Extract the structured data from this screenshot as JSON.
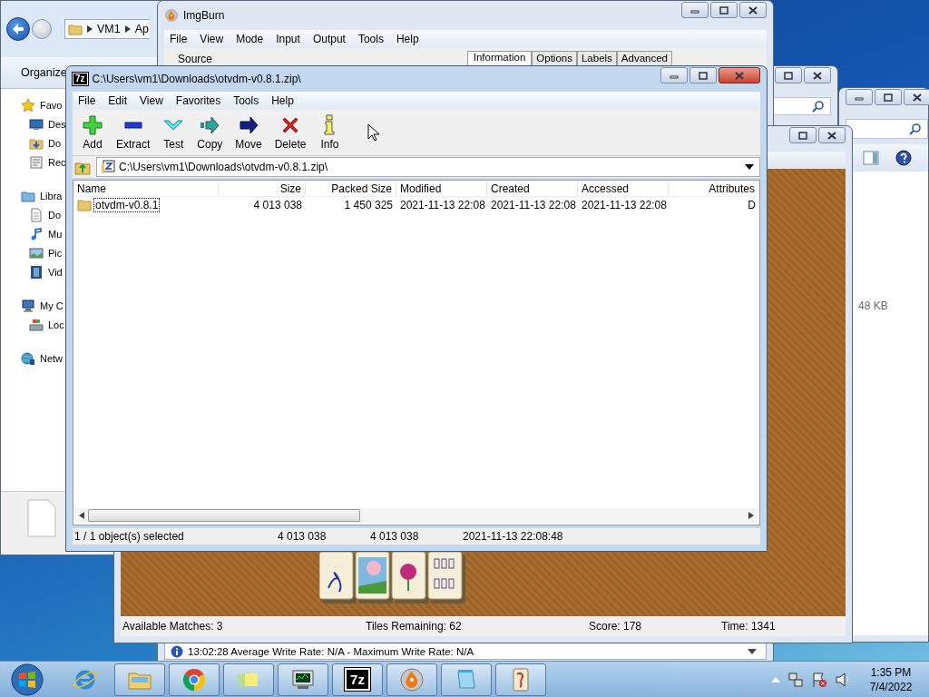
{
  "explorer": {
    "breadcrumb": [
      "VM1",
      "Ap"
    ],
    "toolbar": [
      "Organize"
    ],
    "nav": [
      {
        "label": "Favo",
        "kind": "star",
        "children": [
          {
            "label": "Des",
            "kind": "desktop"
          },
          {
            "label": "Do",
            "kind": "downloads"
          },
          {
            "label": "Rec",
            "kind": "recent"
          }
        ]
      },
      {
        "label": "Libra",
        "kind": "library",
        "children": [
          {
            "label": "Do",
            "kind": "document"
          },
          {
            "label": "Mu",
            "kind": "music"
          },
          {
            "label": "Pic",
            "kind": "pictures"
          },
          {
            "label": "Vid",
            "kind": "video"
          }
        ]
      },
      {
        "label": "My C",
        "kind": "computer",
        "children": [
          {
            "label": "Loc",
            "kind": "disk"
          }
        ]
      },
      {
        "label": "Netw",
        "kind": "network"
      }
    ]
  },
  "explorer_right": {
    "size_text": "48 KB"
  },
  "imgburn": {
    "title": "ImgBurn",
    "menu": [
      "File",
      "View",
      "Mode",
      "Input",
      "Output",
      "Tools",
      "Help"
    ],
    "source_label": "Source",
    "tabs": [
      {
        "label": "Information",
        "selected": true
      },
      {
        "label": "Options",
        "selected": false
      },
      {
        "label": "Labels",
        "selected": false
      },
      {
        "label": "Advanced",
        "selected": false
      }
    ],
    "status": "13:02:28 Average Write Rate: N/A - Maximum Write Rate: N/A"
  },
  "mahjong": {
    "status": [
      "Available Matches: 3",
      "Tiles Remaining: 62",
      "Score: 178",
      "Time: 1341"
    ]
  },
  "archive": {
    "app_badge": "7z",
    "title": "C:\\Users\\vm1\\Downloads\\otvdm-v0.8.1.zip\\",
    "menu": [
      "File",
      "Edit",
      "View",
      "Favorites",
      "Tools",
      "Help"
    ],
    "toolbar": [
      {
        "label": "Add",
        "kind": "add"
      },
      {
        "label": "Extract",
        "kind": "extract"
      },
      {
        "label": "Test",
        "kind": "test"
      },
      {
        "label": "Copy",
        "kind": "copy"
      },
      {
        "label": "Move",
        "kind": "move"
      },
      {
        "label": "Delete",
        "kind": "delete"
      },
      {
        "label": "Info",
        "kind": "info"
      }
    ],
    "path": "C:\\Users\\vm1\\Downloads\\otvdm-v0.8.1.zip\\",
    "columns": [
      "Name",
      "Size",
      "Packed Size",
      "Modified",
      "Created",
      "Accessed",
      "Attributes"
    ],
    "rows": [
      {
        "cells": [
          "otvdm-v0.8.1",
          "4 013 038",
          "1 450 325",
          "2021-11-13 22:08",
          "2021-11-13 22:08",
          "2021-11-13 22:08",
          "D"
        ],
        "focused": true
      }
    ],
    "status": [
      "1 / 1 object(s) selected",
      "4 013 038",
      "4 013 038",
      "2021-11-13 22:08:48"
    ]
  },
  "taskbar": {
    "apps": [
      {
        "kind": "ie",
        "open": false
      },
      {
        "kind": "folder",
        "open": true
      },
      {
        "kind": "chrome",
        "open": true
      },
      {
        "kind": "notes",
        "open": true
      },
      {
        "kind": "monitor",
        "open": true
      },
      {
        "kind": "sevenzip",
        "open": true,
        "label": "7z"
      },
      {
        "kind": "disc",
        "open": true
      },
      {
        "kind": "notepad",
        "open": true
      },
      {
        "kind": "mahjong",
        "open": true
      }
    ],
    "clock": {
      "time": "1:35 PM",
      "date": "7/4/2022"
    }
  }
}
